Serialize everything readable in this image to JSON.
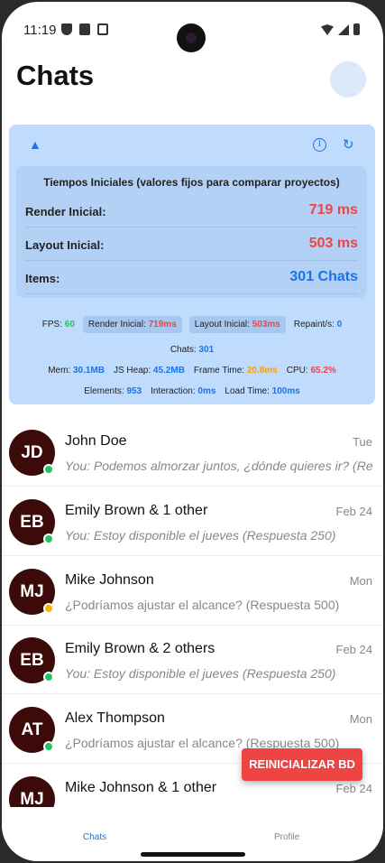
{
  "status_bar": {
    "time": "11:19"
  },
  "header": {
    "title": "Chats"
  },
  "perf_panel": {
    "collapse_icon": "▲",
    "info_icon": "i",
    "refresh_icon": "↻",
    "timing": {
      "title": "Tiempos Iniciales (valores fijos para comparar proyectos)",
      "rows": [
        {
          "label": "Render Inicial:",
          "value": "719 ms",
          "color": "#ef4444"
        },
        {
          "label": "Layout Inicial:",
          "value": "503 ms",
          "color": "#ef4444"
        },
        {
          "label": "Items:",
          "value": "301 Chats",
          "color": "#1a73e8"
        }
      ]
    },
    "metrics": {
      "fps_label": "FPS:",
      "fps_value": "60",
      "render_label": "Render Inicial:",
      "render_value": "719ms",
      "layout_label": "Layout Inicial:",
      "layout_value": "503ms",
      "repaint_label": "Repaint/s:",
      "repaint_value": "0",
      "chats_label": "Chats:",
      "chats_value": "301",
      "mem_label": "Mem:",
      "mem_value": "30.1MB",
      "jsheap_label": "JS Heap:",
      "jsheap_value": "45.2MB",
      "frametime_label": "Frame Time:",
      "frametime_value": "20.8ms",
      "cpu_label": "CPU:",
      "cpu_value": "65.2%",
      "elements_label": "Elements:",
      "elements_value": "953",
      "interaction_label": "Interaction:",
      "interaction_value": "0ms",
      "loadtime_label": "Load Time:",
      "loadtime_value": "100ms"
    }
  },
  "chats": [
    {
      "initials": "JD",
      "name": "John Doe",
      "time": "Tue",
      "preview": "You: Podemos almorzar juntos, ¿dónde quieres ir? (Res…",
      "presence": "online",
      "presence_color": "#22c55e",
      "italic": true
    },
    {
      "initials": "EB",
      "name": "Emily Brown & 1 other",
      "time": "Feb 24",
      "preview": "You: Estoy disponible el jueves (Respuesta 250)",
      "presence": "online",
      "presence_color": "#22c55e",
      "italic": true
    },
    {
      "initials": "MJ",
      "name": "Mike Johnson",
      "time": "Mon",
      "preview": "¿Podríamos ajustar el alcance? (Respuesta 500)",
      "presence": "away",
      "presence_color": "#f5b301",
      "italic": false
    },
    {
      "initials": "EB",
      "name": "Emily Brown & 2 others",
      "time": "Feb 24",
      "preview": "You: Estoy disponible el jueves (Respuesta 250)",
      "presence": "online",
      "presence_color": "#22c55e",
      "italic": true
    },
    {
      "initials": "AT",
      "name": "Alex Thompson",
      "time": "Mon",
      "preview": "¿Podríamos ajustar el alcance? (Respuesta 500)",
      "presence": "online",
      "presence_color": "#22c55e",
      "italic": false
    },
    {
      "initials": "MJ",
      "name": "Mike Johnson & 1 other",
      "time": "Feb 24",
      "preview": "",
      "presence": "",
      "presence_color": "",
      "italic": false
    }
  ],
  "fab": {
    "label": "REINICIALIZAR BD"
  },
  "bottom_nav": {
    "tabs": [
      {
        "label": "Chats",
        "active": true
      },
      {
        "label": "Profile",
        "active": false
      }
    ]
  },
  "colors": {
    "accent": "#1a73e8",
    "danger": "#ef4444",
    "success": "#22c55e",
    "warning": "#f59e0b",
    "avatar_bg": "#3d0a0a",
    "panel_bg": "#bfdbfe"
  }
}
